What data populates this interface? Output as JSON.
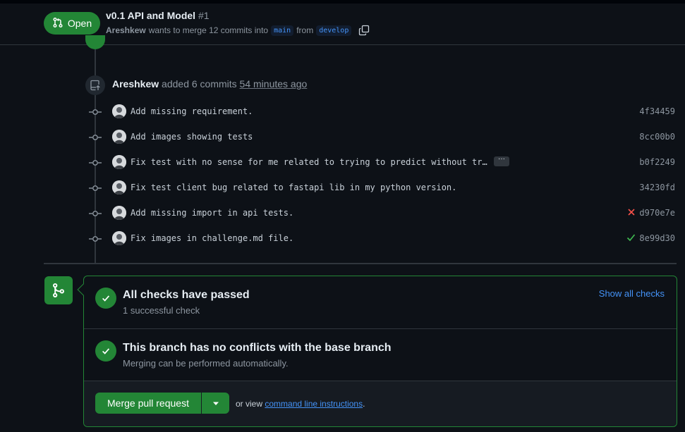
{
  "pr": {
    "state": "Open",
    "title": "v0.1 API and Model",
    "number": "#1",
    "author": "Areshkew",
    "merge_text": "wants to merge 12 commits into",
    "base_branch": "main",
    "from_text": "from",
    "head_branch": "develop"
  },
  "timeline": {
    "added": {
      "author": "Areshkew",
      "text": "added 6 commits",
      "time": "54 minutes ago"
    },
    "commits": [
      {
        "message": "Add missing requirement.",
        "sha": "4f34459",
        "status": ""
      },
      {
        "message": "Add images showing tests",
        "sha": "8cc00b0",
        "status": ""
      },
      {
        "message": "Fix test with no sense for me related to trying to predict without tr…",
        "sha": "b0f2249",
        "status": "",
        "expand_label": "···"
      },
      {
        "message": "Fix test client bug related to fastapi lib in my python version.",
        "sha": "34230fd",
        "status": ""
      },
      {
        "message": "Add missing import in api tests.",
        "sha": "d970e7e",
        "status": "failure"
      },
      {
        "message": "Fix images in challenge.md file.",
        "sha": "8e99d30",
        "status": "success"
      }
    ]
  },
  "merge_box": {
    "checks_title": "All checks have passed",
    "checks_sub": "1 successful check",
    "show_all": "Show all checks",
    "conflicts_title": "This branch has no conflicts with the base branch",
    "conflicts_sub": "Merging can be performed automatically.",
    "merge_button": "Merge pull request",
    "or_view": "or view",
    "cli_link": "command line instructions",
    "period": "."
  },
  "colors": {
    "success": "#238636",
    "failure": "#f85149",
    "link": "#4493f8",
    "background": "#0d1117"
  }
}
